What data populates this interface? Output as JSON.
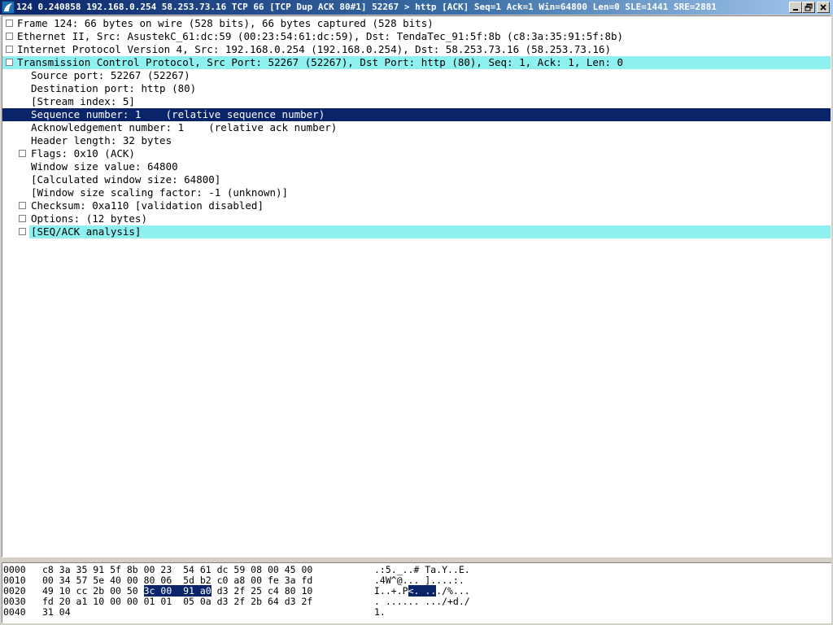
{
  "window": {
    "title": "124 0.240858 192.168.0.254 58.253.73.16 TCP 66 [TCP Dup ACK 80#1] 52267 > http [ACK] Seq=1 Ack=1 Win=64800 Len=0 SLE=1441 SRE=2881",
    "app_icon": "wireshark-fin-icon",
    "controls": {
      "minimize": "minimize-icon",
      "maximize": "restore-icon",
      "close": "close-icon"
    }
  },
  "tree": {
    "frame": "Frame 124: 66 bytes on wire (528 bits), 66 bytes captured (528 bits)",
    "ethernet": "Ethernet II, Src: AsustekC_61:dc:59 (00:23:54:61:dc:59), Dst: TendaTec_91:5f:8b (c8:3a:35:91:5f:8b)",
    "ip": "Internet Protocol Version 4, Src: 192.168.0.254 (192.168.0.254), Dst: 58.253.73.16 (58.253.73.16)",
    "tcp": "Transmission Control Protocol, Src Port: 52267 (52267), Dst Port: http (80), Seq: 1, Ack: 1, Len: 0",
    "src_port": "Source port: 52267 (52267)",
    "dst_port": "Destination port: http (80)",
    "stream_index": "[Stream index: 5]",
    "seq_number": "Sequence number: 1    (relative sequence number)",
    "ack_number": "Acknowledgement number: 1    (relative ack number)",
    "header_length": "Header length: 32 bytes",
    "flags": "Flags: 0x10 (ACK)",
    "window_size": "Window size value: 64800",
    "calc_window": "[Calculated window size: 64800]",
    "window_scaling": "[Window size scaling factor: -1 (unknown)]",
    "checksum": "Checksum: 0xa110 [validation disabled]",
    "options": "Options: (12 bytes)",
    "seq_ack": "[SEQ/ACK analysis]"
  },
  "hex": {
    "rows": [
      {
        "offset": "0000",
        "bytes_a": "c8 3a 35 91 5f 8b 00 23  54 61 dc 59 08 00 45 00",
        "bytes_hl": "",
        "bytes_b": "",
        "ascii_a": ".:5._..# Ta.Y..E.",
        "ascii_hl": "",
        "ascii_b": ""
      },
      {
        "offset": "0010",
        "bytes_a": "00 34 57 5e 40 00 80 06  5d b2 c0 a8 00 fe 3a fd",
        "bytes_hl": "",
        "bytes_b": "",
        "ascii_a": ".4W^@... ]....:.",
        "ascii_hl": "",
        "ascii_b": ""
      },
      {
        "offset": "0020",
        "bytes_a": "49 10 cc 2b 00 50 ",
        "bytes_hl": "3c 00  91 a0",
        "bytes_b": " d3 2f 25 c4 80 10",
        "ascii_a": "I..+.P",
        "ascii_hl": "<. ..",
        "ascii_b": "./%..."
      },
      {
        "offset": "0030",
        "bytes_a": "fd 20 a1 10 00 00 01 01  05 0a d3 2f 2b 64 d3 2f",
        "bytes_hl": "",
        "bytes_b": "",
        "ascii_a": ". ...... .../+d./",
        "ascii_hl": "",
        "ascii_b": ""
      },
      {
        "offset": "0040",
        "bytes_a": "31 04",
        "bytes_hl": "",
        "bytes_b": "",
        "ascii_a": "1.",
        "ascii_hl": "",
        "ascii_b": ""
      }
    ]
  }
}
